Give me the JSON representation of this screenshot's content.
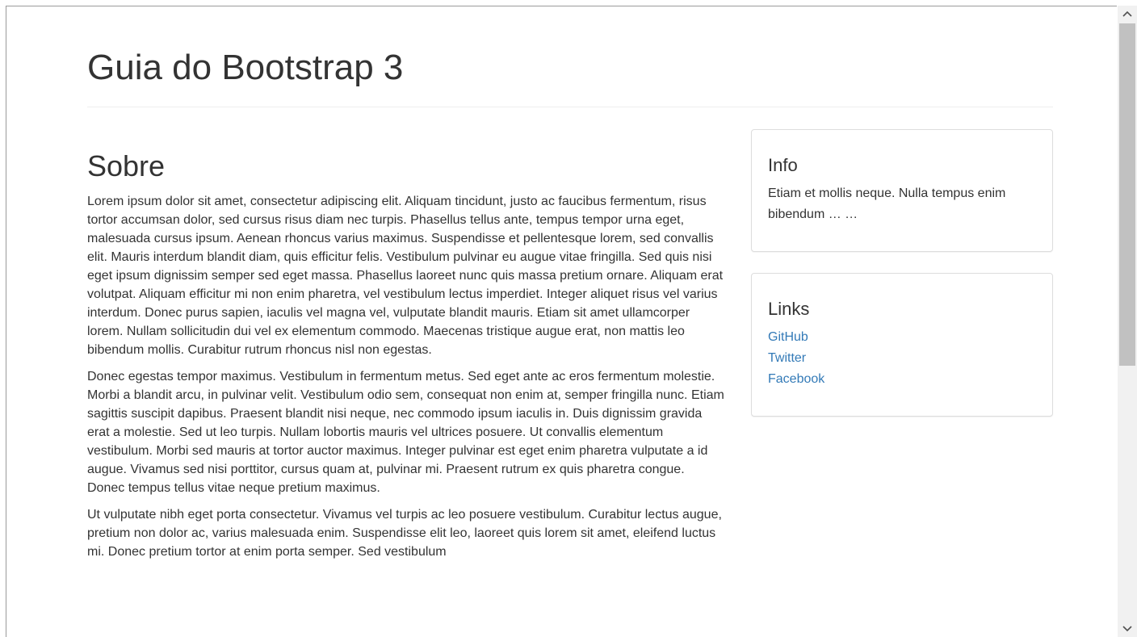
{
  "page": {
    "title": "Guia do Bootstrap 3"
  },
  "main": {
    "section_title": "Sobre",
    "paragraphs": [
      "Lorem ipsum dolor sit amet, consectetur adipiscing elit. Aliquam tincidunt, justo ac faucibus fermentum, risus tortor accumsan dolor, sed cursus risus diam nec turpis. Phasellus tellus ante, tempus tempor urna eget, malesuada cursus ipsum. Aenean rhoncus varius maximus. Suspendisse et pellentesque lorem, sed convallis elit. Mauris interdum blandit diam, quis efficitur felis. Vestibulum pulvinar eu augue vitae fringilla. Sed quis nisi eget ipsum dignissim semper sed eget massa. Phasellus laoreet nunc quis massa pretium ornare. Aliquam erat volutpat. Aliquam efficitur mi non enim pharetra, vel vestibulum lectus imperdiet. Integer aliquet risus vel varius interdum. Donec purus sapien, iaculis vel magna vel, vulputate blandit mauris. Etiam sit amet ullamcorper lorem. Nullam sollicitudin dui vel ex elementum commodo. Maecenas tristique augue erat, non mattis leo bibendum mollis. Curabitur rutrum rhoncus nisl non egestas.",
      "Donec egestas tempor maximus. Vestibulum in fermentum metus. Sed eget ante ac eros fermentum molestie. Morbi a blandit arcu, in pulvinar velit. Vestibulum odio sem, consequat non enim at, semper fringilla nunc. Etiam sagittis suscipit dapibus. Praesent blandit nisi neque, nec commodo ipsum iaculis in. Duis dignissim gravida erat a molestie. Sed ut leo turpis. Nullam lobortis mauris vel ultrices posuere. Ut convallis elementum vestibulum. Morbi sed mauris at tortor auctor maximus. Integer pulvinar est eget enim pharetra vulputate a id augue. Vivamus sed nisi porttitor, cursus quam at, pulvinar mi. Praesent rutrum ex quis pharetra congue. Donec tempus tellus vitae neque pretium maximus.",
      "Ut vulputate nibh eget porta consectetur. Vivamus vel turpis ac leo posuere vestibulum. Curabitur lectus augue, pretium non dolor ac, varius malesuada enim. Suspendisse elit leo, laoreet quis lorem sit amet, eleifend luctus mi. Donec pretium tortor at enim porta semper. Sed vestibulum"
    ]
  },
  "sidebar": {
    "info": {
      "title": "Info",
      "text": "Etiam et mollis neque. Nulla tempus enim bibendum … …"
    },
    "links": {
      "title": "Links",
      "items": [
        {
          "label": "GitHub"
        },
        {
          "label": "Twitter"
        },
        {
          "label": "Facebook"
        }
      ]
    }
  },
  "scrollbar": {
    "up_icon": "chevron-up-icon",
    "down_icon": "chevron-down-icon"
  },
  "colors": {
    "link": "#337ab7",
    "text": "#333333",
    "border": "#dddddd"
  }
}
